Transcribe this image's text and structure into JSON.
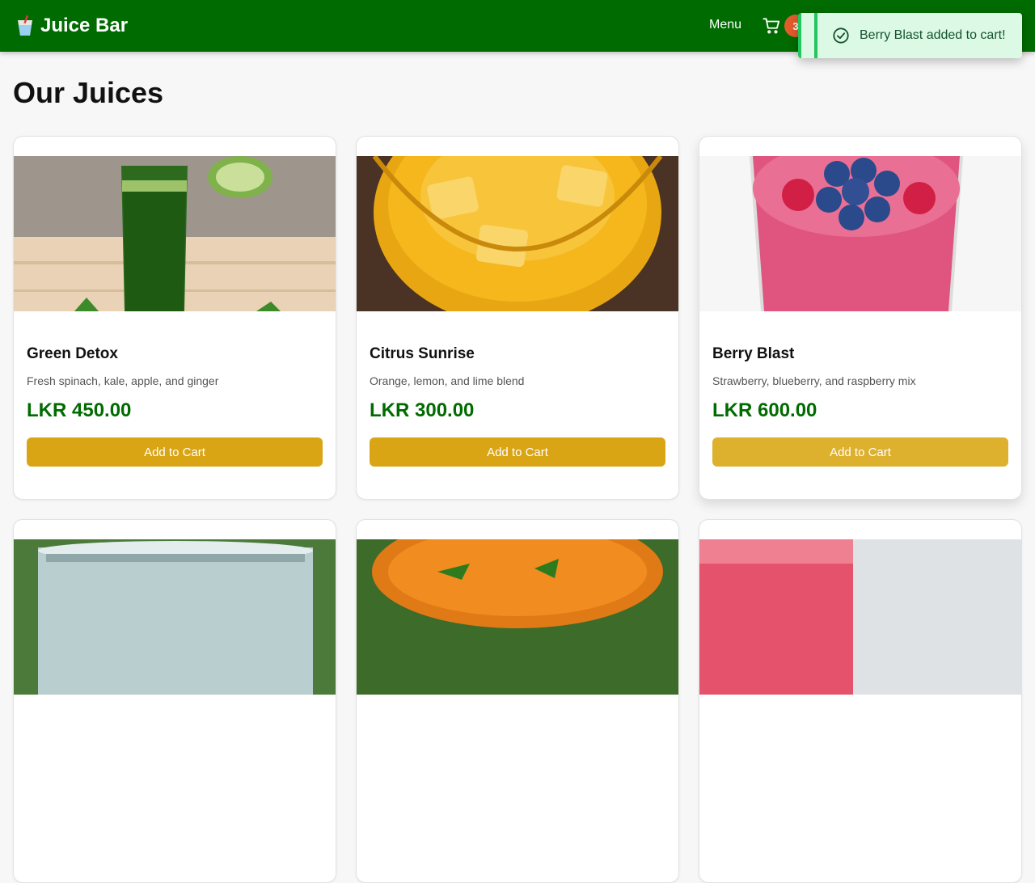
{
  "header": {
    "brand_name": "Juice Bar",
    "brand_icon": "juice-cup-icon",
    "nav_menu_label": "Menu",
    "cart_icon": "cart-icon",
    "cart_count": "3",
    "bg_color": "#006b00",
    "badge_color": "#e25c2b"
  },
  "toast": {
    "message": "Berry Blast added to cart!",
    "icon": "check-circle-icon",
    "accent_color": "#22c55e"
  },
  "page": {
    "title": "Our Juices"
  },
  "products": [
    {
      "name": "Green Detox",
      "description": "Fresh spinach, kale, apple, and ginger",
      "price": "LKR 450.00",
      "button_label": "Add to Cart"
    },
    {
      "name": "Citrus Sunrise",
      "description": "Orange, lemon, and lime blend",
      "price": "LKR 300.00",
      "button_label": "Add to Cart"
    },
    {
      "name": "Berry Blast",
      "description": "Strawberry, blueberry, and raspberry mix",
      "price": "LKR 600.00",
      "button_label": "Add to Cart"
    }
  ],
  "colors": {
    "price": "#006b00",
    "button": "#d9a515"
  }
}
